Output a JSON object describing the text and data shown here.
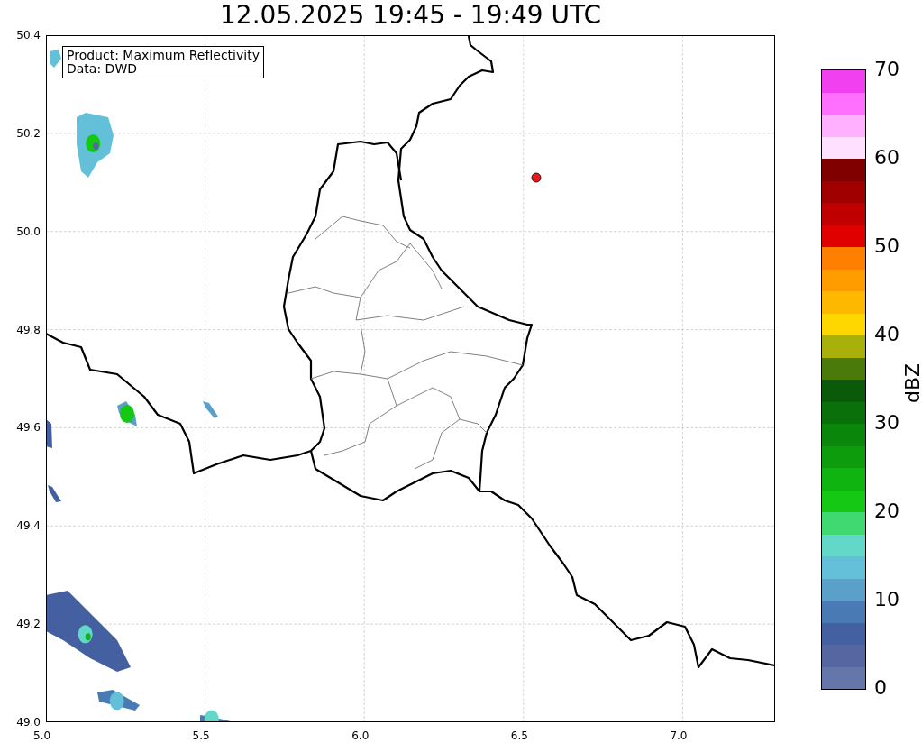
{
  "title": "12.05.2025 19:45 - 19:49 UTC",
  "map": {
    "legend": [
      "Product: Maximum Reflectivity",
      "Data: DWD"
    ],
    "x_ticks": [
      "5.0",
      "5.5",
      "6.0",
      "6.5",
      "7.0"
    ],
    "y_ticks": [
      "50.4",
      "50.2",
      "50.0",
      "49.8",
      "49.6",
      "49.4",
      "49.2",
      "49.0"
    ]
  },
  "colorbar": {
    "label": "dBZ",
    "ticks": [
      "70",
      "60",
      "50",
      "40",
      "30",
      "20",
      "10",
      "0"
    ],
    "bins": [
      {
        "color": "#f040f0"
      },
      {
        "color": "#ff70ff"
      },
      {
        "color": "#ffb0ff"
      },
      {
        "color": "#ffe0ff"
      },
      {
        "color": "#800000"
      },
      {
        "color": "#a00000"
      },
      {
        "color": "#c00000"
      },
      {
        "color": "#e00000"
      },
      {
        "color": "#ff7f00"
      },
      {
        "color": "#ff9c00"
      },
      {
        "color": "#ffb800"
      },
      {
        "color": "#ffd700"
      },
      {
        "color": "#aab00a"
      },
      {
        "color": "#4a7a0a"
      },
      {
        "color": "#0a5a0a"
      },
      {
        "color": "#0a700a"
      },
      {
        "color": "#0a860a"
      },
      {
        "color": "#0c9c0c"
      },
      {
        "color": "#10b410"
      },
      {
        "color": "#14c814"
      },
      {
        "color": "#40d870"
      },
      {
        "color": "#64d8c8"
      },
      {
        "color": "#64c0d8"
      },
      {
        "color": "#5aa0c8"
      },
      {
        "color": "#4a7ab4"
      },
      {
        "color": "#4460a0"
      },
      {
        "color": "#5566a0"
      },
      {
        "color": "#6577aa"
      }
    ]
  }
}
